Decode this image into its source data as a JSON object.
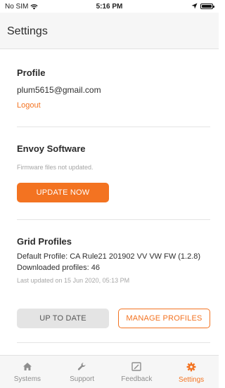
{
  "status_bar": {
    "carrier": "No SIM",
    "time": "5:16 PM"
  },
  "header": {
    "title": "Settings"
  },
  "profile": {
    "title": "Profile",
    "email": "plum5615@gmail.com",
    "logout_label": "Logout"
  },
  "envoy": {
    "title": "Envoy Software",
    "status": "Firmware files not updated.",
    "update_label": "UPDATE NOW"
  },
  "grid": {
    "title": "Grid Profiles",
    "default_profile": "Default Profile: CA Rule21 201902 VV VW FW (1.2.8)",
    "downloaded": "Downloaded profiles: 46",
    "last_updated": "Last updated on 15 Jun 2020, 05:13 PM",
    "up_to_date_label": "UP TO DATE",
    "manage_label": "MANAGE PROFILES"
  },
  "tabs": [
    {
      "label": "Systems",
      "icon": "home-icon"
    },
    {
      "label": "Support",
      "icon": "wrench-icon"
    },
    {
      "label": "Feedback",
      "icon": "feedback-icon"
    },
    {
      "label": "Settings",
      "icon": "gear-icon",
      "active": true
    }
  ],
  "colors": {
    "accent": "#f37321",
    "inactive": "#8e8e8e"
  }
}
